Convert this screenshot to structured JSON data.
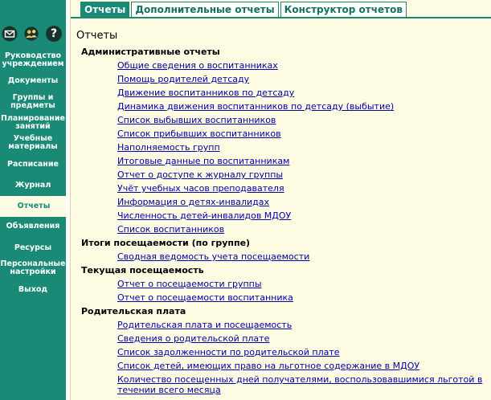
{
  "tabs": [
    {
      "label": "Отчеты",
      "active": true
    },
    {
      "label": "Дополнительные отчеты",
      "active": false
    },
    {
      "label": "Конструктор отчетов",
      "active": false
    }
  ],
  "sidebar": {
    "items": [
      {
        "label": "Руководство\nучреждением"
      },
      {
        "label": "Документы"
      },
      {
        "label": "Группы и\nпредметы"
      },
      {
        "label": "Планирование\nзанятий"
      },
      {
        "label": "Учебные\nматериалы"
      },
      {
        "label": "Расписание"
      },
      {
        "label": "Журнал"
      },
      {
        "label": "Отчеты",
        "active": true
      },
      {
        "label": "Объявления"
      },
      {
        "label": "Ресурсы"
      },
      {
        "label": "Персональные\nнастройки"
      },
      {
        "label": "Выход"
      }
    ]
  },
  "page_title": "Отчеты",
  "sections": [
    {
      "title": "Административные отчеты",
      "links": [
        "Общие сведения о воспитанниках",
        "Помощь родителей детсаду",
        "Движение воспитанников по детсаду",
        "Динамика движения воспитанников по детсаду (выбытие)",
        "Список выбывших воспитанников",
        "Список прибывших воспитанников",
        "Наполняемость групп",
        "Итоговые данные по воспитанникам",
        "Отчет о доступе к журналу группы",
        "Учёт учебных часов преподавателя",
        "Информация о детях-инвалидах",
        "Численность детей-инвалидов МДОУ",
        "Список воспитанников"
      ]
    },
    {
      "title": "Итоги посещаемости (по группе)",
      "links": [
        "Сводная ведомость учета посещаемости"
      ]
    },
    {
      "title": "Текущая посещаемость",
      "links": [
        "Отчет о посещаемости группы",
        "Отчет о посещаемости воспитанника"
      ]
    },
    {
      "title": "Родительская плата",
      "links": [
        "Родительская плата и посещаемость",
        "Сведения о родительской плате",
        "Список задолженности по родительской плате",
        "Список детей, имеющих право на льготное содержание в МДОУ",
        "Количество посещенных дней получателями, воспользовавшимися льготой в течении всего месяца"
      ]
    }
  ],
  "colors": {
    "sidebar": "#1a8a76",
    "background": "#fefbe3",
    "link": "#0000aa"
  }
}
